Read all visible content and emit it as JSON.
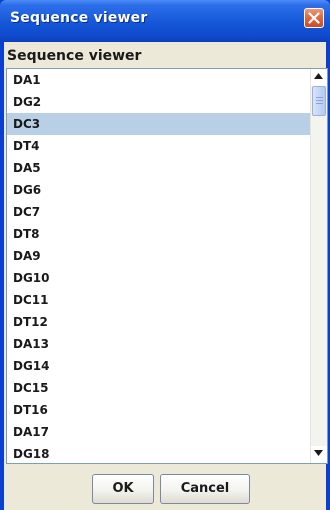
{
  "window": {
    "title": "Sequence viewer"
  },
  "header": {
    "label": "Sequence viewer"
  },
  "list": {
    "items": [
      {
        "label": "DA1",
        "selected": false
      },
      {
        "label": "DG2",
        "selected": false
      },
      {
        "label": "DC3",
        "selected": true
      },
      {
        "label": "DT4",
        "selected": false
      },
      {
        "label": "DA5",
        "selected": false
      },
      {
        "label": "DG6",
        "selected": false
      },
      {
        "label": "DC7",
        "selected": false
      },
      {
        "label": "DT8",
        "selected": false
      },
      {
        "label": "DA9",
        "selected": false
      },
      {
        "label": "DG10",
        "selected": false
      },
      {
        "label": "DC11",
        "selected": false
      },
      {
        "label": "DT12",
        "selected": false
      },
      {
        "label": "DA13",
        "selected": false
      },
      {
        "label": "DG14",
        "selected": false
      },
      {
        "label": "DC15",
        "selected": false
      },
      {
        "label": "DT16",
        "selected": false
      },
      {
        "label": "DA17",
        "selected": false
      },
      {
        "label": "DG18",
        "selected": false
      }
    ]
  },
  "buttons": {
    "ok_label": "OK",
    "cancel_label": "Cancel"
  },
  "icons": {
    "close": "close-icon",
    "scroll_up": "arrow-up-icon",
    "scroll_down": "arrow-down-icon"
  },
  "colors": {
    "title_bar": "#1556d8",
    "selection": "#b8cfe5",
    "close_button": "#df6a44"
  }
}
